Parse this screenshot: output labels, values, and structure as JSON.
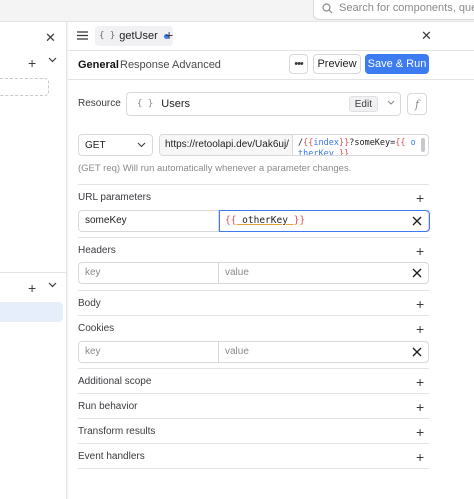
{
  "search": {
    "placeholder": "Search for components, queries"
  },
  "query": {
    "name": "getUser",
    "tabs": [
      "General",
      "Response",
      "Advanced"
    ],
    "more_label": "•••",
    "preview_label": "Preview",
    "save_run_label": "Save & Run",
    "resource_label": "Resource",
    "resource_name": "Users",
    "edit_label": "Edit",
    "fx_label": "f",
    "method": "GET",
    "url_base": "https://retoolapi.dev/Uak6uj/",
    "url_path_parts": [
      "/",
      "{{",
      "index",
      "}}",
      "?someKey=",
      "{{",
      " otherKey ",
      "}}"
    ],
    "hint": "(GET req) Will run automatically whenever a parameter changes.",
    "sections": {
      "url_params": "URL parameters",
      "headers": "Headers",
      "body": "Body",
      "cookies": "Cookies",
      "additional_scope": "Additional scope",
      "run_behavior": "Run behavior",
      "transform_results": "Transform results",
      "event_handlers": "Event handlers"
    },
    "url_param_row": {
      "key": "someKey",
      "value_open": "{{",
      "value_var": " otherKey ",
      "value_close": "}}"
    },
    "header_row": {
      "key_placeholder": "key",
      "value_placeholder": "value"
    },
    "cookie_row": {
      "key_placeholder": "key",
      "value_placeholder": "value"
    }
  },
  "colors": {
    "accent": "#3d7bf0",
    "template": "#d9534f"
  }
}
